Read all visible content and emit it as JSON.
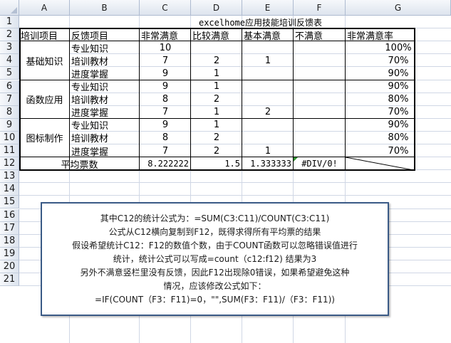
{
  "columns": [
    "A",
    "B",
    "C",
    "D",
    "E",
    "F",
    "G"
  ],
  "rows": [
    "1",
    "2",
    "3",
    "4",
    "5",
    "6",
    "7",
    "8",
    "9",
    "10",
    "11",
    "12",
    "13",
    "14",
    "15",
    "16",
    "17",
    "18",
    "19",
    "20",
    "21"
  ],
  "sheet": {
    "title": "excelhome应用技能培训反馈表",
    "headers": [
      "培训项目",
      "反馈项目",
      "非常满意",
      "比较满意",
      "基本满意",
      "不满意",
      "非常满意率"
    ],
    "groups": [
      "基础知识",
      "函数应用",
      "图标制作"
    ],
    "items": [
      "专业知识",
      "培训教材",
      "进度掌握"
    ],
    "data": [
      {
        "c": "10",
        "d": "",
        "e": "",
        "g": "100%"
      },
      {
        "c": "7",
        "d": "2",
        "e": "1",
        "g": "70%"
      },
      {
        "c": "9",
        "d": "1",
        "e": "",
        "g": "90%"
      },
      {
        "c": "9",
        "d": "1",
        "e": "",
        "g": "90%"
      },
      {
        "c": "8",
        "d": "2",
        "e": "",
        "g": "80%"
      },
      {
        "c": "7",
        "d": "1",
        "e": "2",
        "g": "70%"
      },
      {
        "c": "9",
        "d": "1",
        "e": "",
        "g": "90%"
      },
      {
        "c": "8",
        "d": "2",
        "e": "",
        "g": "80%"
      },
      {
        "c": "7",
        "d": "2",
        "e": "1",
        "g": "70%"
      }
    ],
    "avg_label": "平均票数",
    "avg": {
      "c": "8.222222",
      "d": "1.5",
      "e": "1.333333",
      "f": "#DIV/0!"
    }
  },
  "note": [
    "其中C12的统计公式为：=SUM(C3:C11)/COUNT(C3:C11)",
    "公式从C12横向复制到F12，既得求得所有平均票的结果",
    "假设希望统计C12：F12的数值个数，由于COUNT函数可以忽略错误值进行",
    "统计，统计公式可以写成=count（c12:f12)      结果为3",
    "另外不满意竖栏里没有反馈，因此F12出现除0错误，如果希望避免这种",
    "情况，应该修改公式如下：",
    "=IF(COUNT（F3：F11)=0，\"\",SUM(F3：F11)/（F3：F11))"
  ]
}
